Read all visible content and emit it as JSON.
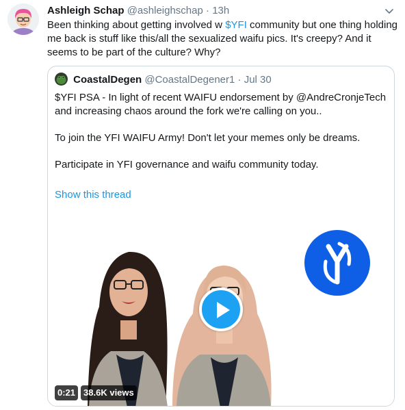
{
  "tweet": {
    "author_name": "Ashleigh Schap",
    "author_handle": "@ashleighschap",
    "separator": "·",
    "time": "13h",
    "text_before": "Been thinking about getting involved w ",
    "cashtag": "$YFI",
    "text_after": " community but one thing holding me back is stuff like this/all the sexualized waifu pics. It's creepy? And it seems to be part of the culture? Why?"
  },
  "quoted": {
    "author_name": "CoastalDegen",
    "author_handle": "@CoastalDegener1",
    "separator": "·",
    "date": "Jul 30",
    "paragraph_1": "$YFI PSA - In light of recent WAIFU endorsement by @AndreCronjeTech and increasing chaos around the fork we're calling on you..",
    "paragraph_2": "To join the YFI WAIFU Army! Don't let your memes only be dreams.",
    "paragraph_3": "Participate in YFI governance and waifu community today.",
    "show_thread": "Show this thread",
    "video": {
      "duration": "0:21",
      "views": "38.6K views"
    }
  },
  "icons": {
    "caret": "chevron-down-icon",
    "play": "play-icon",
    "yfi_logo": "yfi-logo-icon"
  },
  "colors": {
    "link": "#1b95e0",
    "play_button": "#1da1f2",
    "yfi_logo": "#0f5fe6",
    "border": "#ccd6dd",
    "secondary_text": "#657786"
  }
}
